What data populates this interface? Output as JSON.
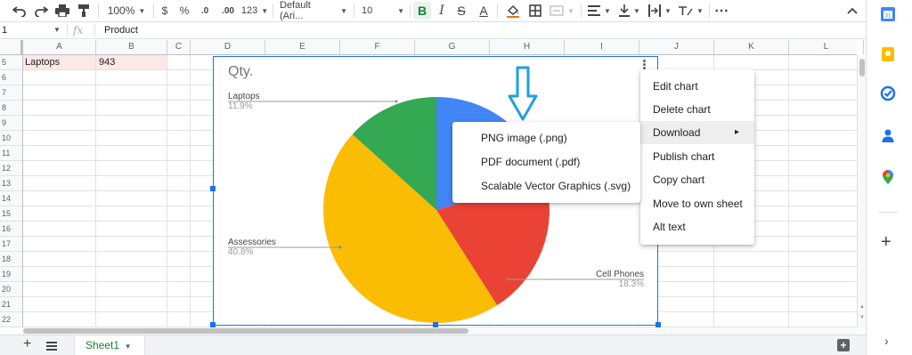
{
  "toolbar": {
    "zoom": "100%",
    "currency_symbol": "$",
    "percent_symbol": "%",
    "decrease_decimals": ".0",
    "increase_decimals": ".00",
    "more_formats": "123",
    "font_family": "Default (Ari...",
    "font_size": "10",
    "bold_label": "B",
    "italic_label": "I",
    "strikethrough_label": "S",
    "text_color_label": "A",
    "more_label": "⋯"
  },
  "formula_bar": {
    "name_box": "1",
    "fx_label": "fx",
    "content": "Product"
  },
  "grid": {
    "columns": [
      "A",
      "B",
      "C",
      "D",
      "E",
      "F",
      "G",
      "H",
      "I",
      "J",
      "K",
      "L"
    ],
    "rows": [
      "5",
      "6",
      "7",
      "8",
      "9",
      "10",
      "11",
      "12",
      "13",
      "14",
      "15",
      "16",
      "17",
      "18",
      "19",
      "20",
      "21",
      "22"
    ],
    "cell_a5": "Laptops",
    "cell_b5": "943",
    "highlight_color": "#fce8e6"
  },
  "chart_data": {
    "type": "pie",
    "title": "Qty.",
    "slices": [
      {
        "label": "Laptops",
        "percent": 11.9,
        "color": "#34a853"
      },
      {
        "label": "",
        "percent": 18.3,
        "color": "#4285f4"
      },
      {
        "label": "Cell Phones",
        "percent": 18.3,
        "color": "#ea4335"
      },
      {
        "label": "Assessories",
        "percent": 40.8,
        "color": "#fbbc04"
      }
    ],
    "value_labels": {
      "laptops": "11.9%",
      "assessories": "40.8%",
      "cell_phones": "18.3%"
    }
  },
  "chart_menu": {
    "items": [
      "Edit chart",
      "Delete chart",
      "Download",
      "Publish chart",
      "Copy chart",
      "Move to own sheet",
      "Alt text"
    ],
    "submenu_arrow": "▸"
  },
  "download_submenu": {
    "items": [
      "PNG image (.png)",
      "PDF document (.pdf)",
      "Scalable Vector Graphics (.svg)"
    ]
  },
  "sheets": {
    "add_label": "+",
    "active_tab": "Sheet1",
    "tab_caret": "▾"
  },
  "side_panel": {
    "add_label": "+",
    "expand_label": "›"
  },
  "colors": {
    "accent": "#1a73e8",
    "arrow": "#1ea0e0",
    "sheet_green": "#188038"
  }
}
